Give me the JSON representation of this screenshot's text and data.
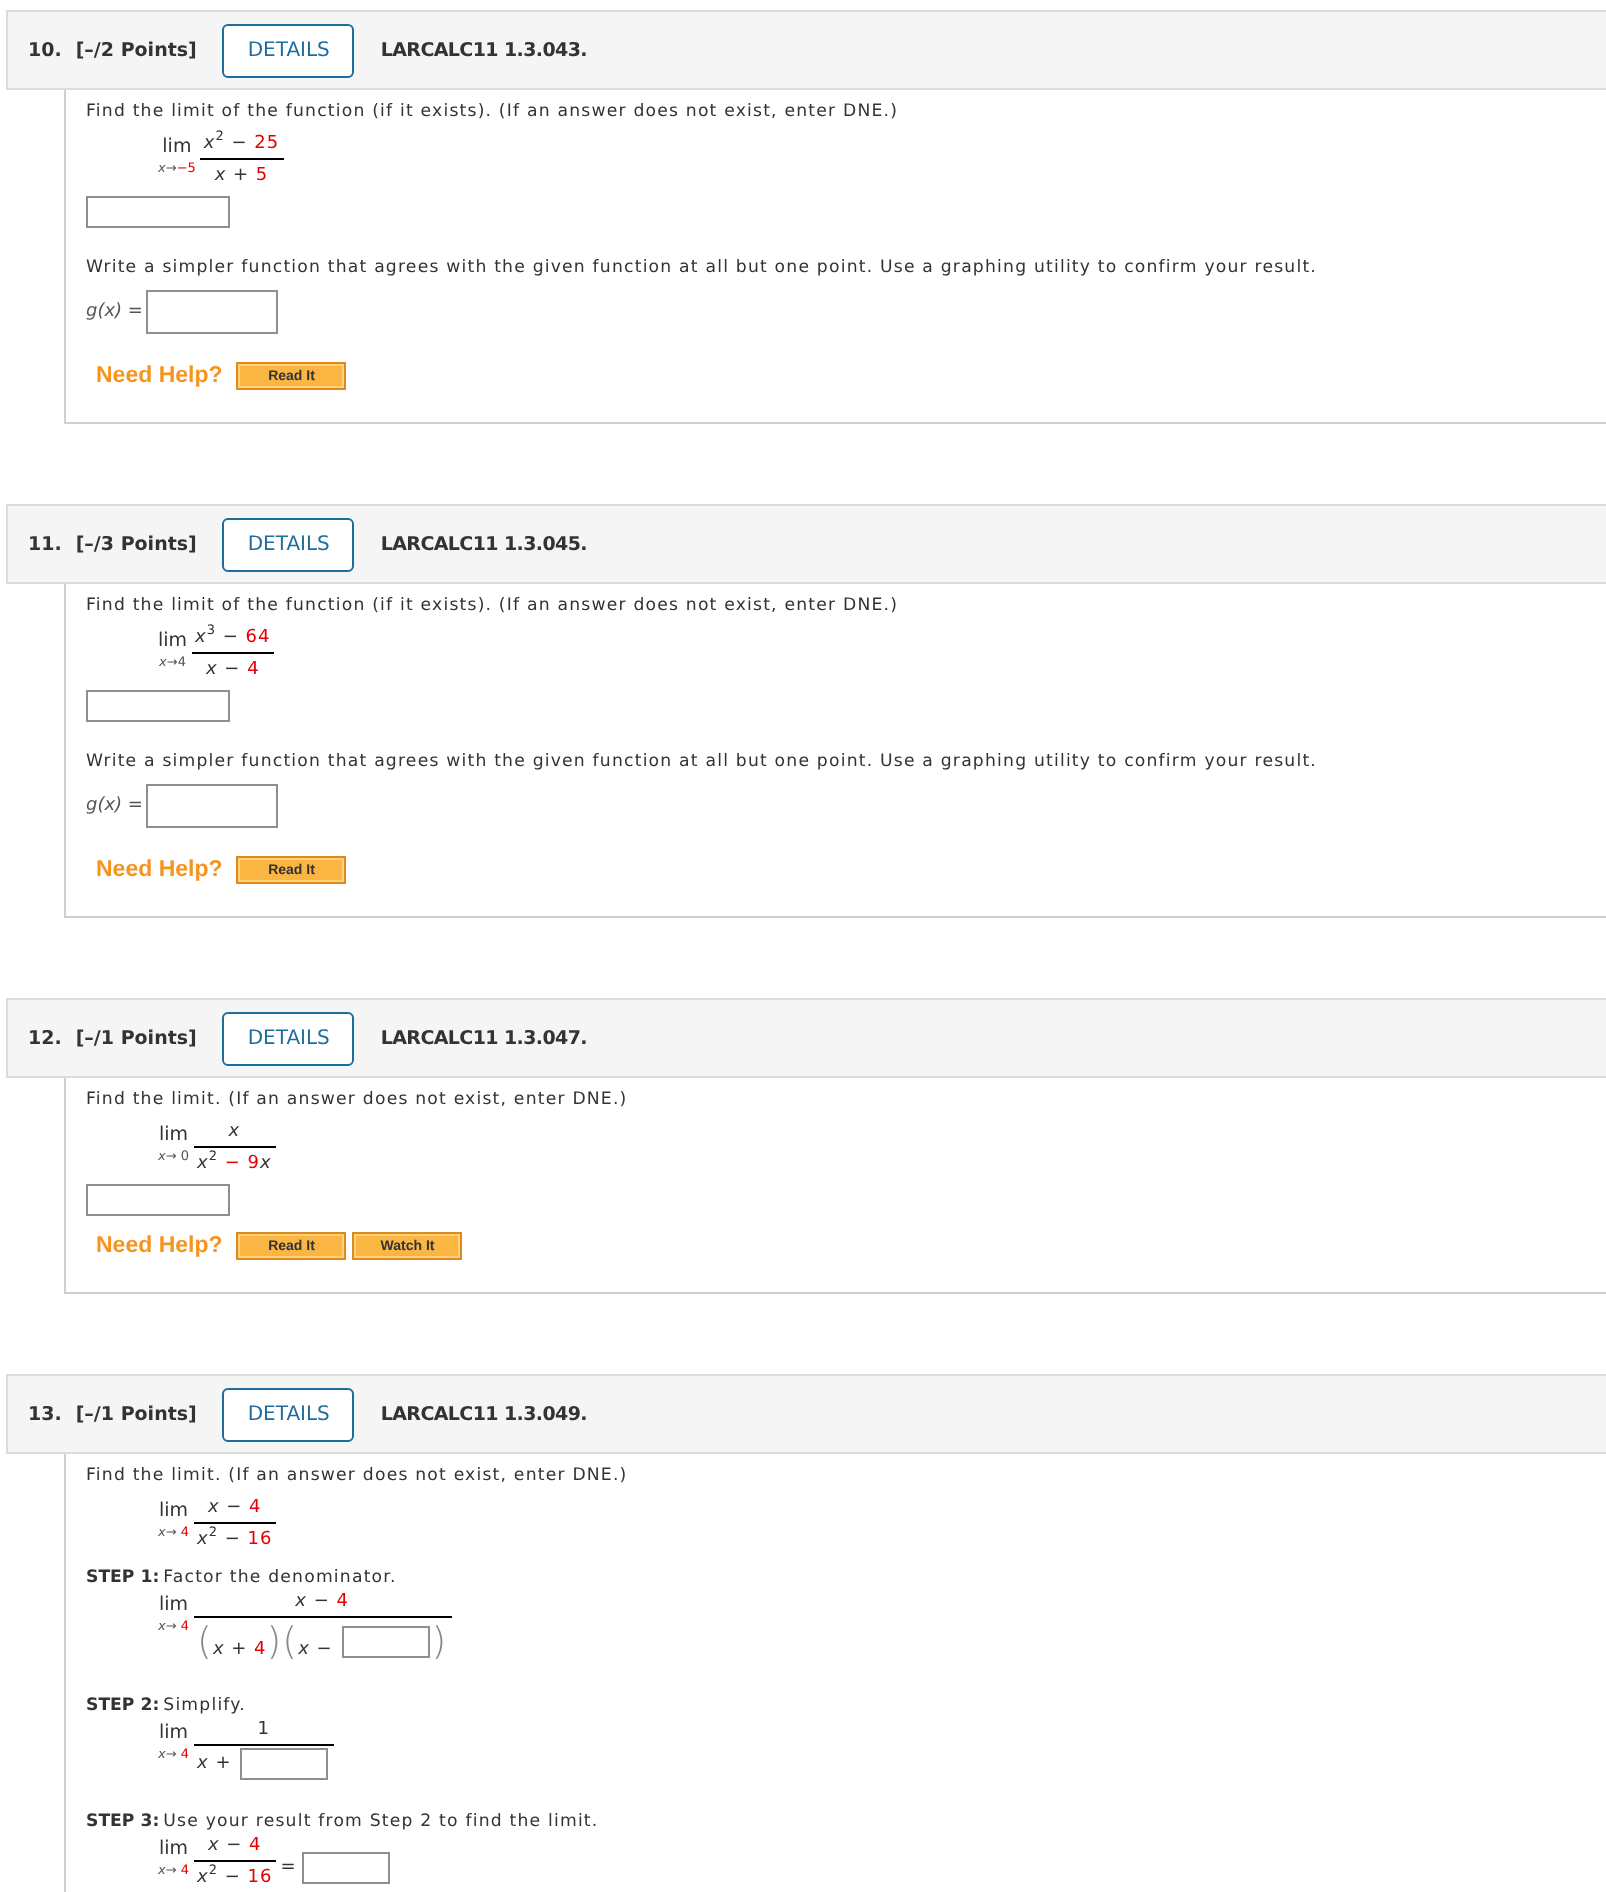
{
  "problems": [
    {
      "number": "10.",
      "points": "[–/2 Points]",
      "details": "DETAILS",
      "source": "LARCALC11 1.3.043.",
      "parts": [
        {
          "kind": "instruction",
          "text": "Find the limit of the function (if it exists). (If an answer does not exist, enter DNE.)"
        },
        {
          "kind": "limit",
          "lim": "lim",
          "approach": [
            {
              "kind": "var",
              "text": "x"
            },
            {
              "kind": "plain",
              "text": "→"
            },
            {
              "kind": "value",
              "text": "−5"
            }
          ],
          "numerator": [
            {
              "kind": "var",
              "text": "x"
            },
            {
              "kind": "sup",
              "text": "2"
            },
            {
              "kind": "plain",
              "text": " − "
            },
            {
              "kind": "value",
              "text": "25"
            }
          ],
          "denominator": [
            {
              "kind": "var",
              "text": "x"
            },
            {
              "kind": "plain",
              "text": " + "
            },
            {
              "kind": "value",
              "text": "5"
            }
          ]
        },
        {
          "kind": "answer_field"
        },
        {
          "kind": "instruction",
          "text": "Write a simpler function that agrees with the given function at all but one point. Use a graphing utility to confirm your result."
        },
        {
          "kind": "function_answer",
          "label": [
            {
              "kind": "var",
              "text": "g(x)"
            },
            {
              "kind": "plain",
              "text": " ="
            }
          ]
        }
      ],
      "help": {
        "label": "Need Help?",
        "buttons": [
          "Read It"
        ]
      }
    },
    {
      "number": "11.",
      "points": "[–/3 Points]",
      "details": "DETAILS",
      "source": "LARCALC11 1.3.045.",
      "parts": [
        {
          "kind": "instruction",
          "text": "Find the limit of the function (if it exists). (If an answer does not exist, enter DNE.)"
        },
        {
          "kind": "limit",
          "lim": "lim",
          "approach": [
            {
              "kind": "var",
              "text": "x"
            },
            {
              "kind": "plain",
              "text": "→"
            },
            {
              "kind": "plain",
              "text": "4"
            }
          ],
          "numerator": [
            {
              "kind": "var",
              "text": "x"
            },
            {
              "kind": "sup",
              "text": "3"
            },
            {
              "kind": "plain",
              "text": " − "
            },
            {
              "kind": "value",
              "text": "64"
            }
          ],
          "denominator": [
            {
              "kind": "var",
              "text": "x"
            },
            {
              "kind": "plain",
              "text": " − "
            },
            {
              "kind": "value",
              "text": "4"
            }
          ]
        },
        {
          "kind": "answer_field"
        },
        {
          "kind": "instruction",
          "text": "Write a simpler function that agrees with the given function at all but one point. Use a graphing utility to confirm your result."
        },
        {
          "kind": "function_answer",
          "label": [
            {
              "kind": "var",
              "text": "g(x)"
            },
            {
              "kind": "plain",
              "text": " ="
            }
          ]
        }
      ],
      "help": {
        "label": "Need Help?",
        "buttons": [
          "Read It"
        ]
      }
    },
    {
      "number": "12.",
      "points": "[–/1 Points]",
      "details": "DETAILS",
      "source": "LARCALC11 1.3.047.",
      "parts": [
        {
          "kind": "instruction",
          "text": "Find the limit. (If an answer does not exist, enter DNE.)"
        },
        {
          "kind": "limit",
          "lim": "lim",
          "approach": [
            {
              "kind": "var",
              "text": "x"
            },
            {
              "kind": "plain",
              "text": "→ 0"
            }
          ],
          "numerator": [
            {
              "kind": "var",
              "text": "x"
            }
          ],
          "denominator": [
            {
              "kind": "var",
              "text": "x"
            },
            {
              "kind": "sup",
              "text": "2"
            },
            {
              "kind": "value",
              "text": " − 9"
            },
            {
              "kind": "var",
              "text": "x"
            }
          ]
        },
        {
          "kind": "answer_field"
        }
      ],
      "help": {
        "label": "Need Help?",
        "buttons": [
          "Read It",
          "Watch It"
        ]
      }
    },
    {
      "number": "13.",
      "points": "[–/1 Points]",
      "details": "DETAILS",
      "source": "LARCALC11 1.3.049.",
      "parts": [
        {
          "kind": "instruction",
          "text": "Find the limit. (If an answer does not exist, enter DNE.)"
        },
        {
          "kind": "limit",
          "lim": "lim",
          "approach": [
            {
              "kind": "var",
              "text": "x"
            },
            {
              "kind": "plain",
              "text": "→ "
            },
            {
              "kind": "value",
              "text": "4"
            }
          ],
          "numerator": [
            {
              "kind": "var",
              "text": "x"
            },
            {
              "kind": "plain",
              "text": " − "
            },
            {
              "kind": "value",
              "text": "4"
            }
          ],
          "denominator": [
            {
              "kind": "var",
              "text": "x"
            },
            {
              "kind": "sup",
              "text": "2"
            },
            {
              "kind": "plain",
              "text": " − "
            },
            {
              "kind": "value",
              "text": "16"
            }
          ]
        },
        {
          "kind": "step",
          "label": "STEP 1:",
          "text": "Factor the denominator."
        },
        {
          "kind": "limit",
          "lim": "lim",
          "approach": [
            {
              "kind": "var",
              "text": "x"
            },
            {
              "kind": "plain",
              "text": "→ "
            },
            {
              "kind": "value",
              "text": "4"
            }
          ],
          "numerator": [
            {
              "kind": "var",
              "text": "x"
            },
            {
              "kind": "plain",
              "text": " − "
            },
            {
              "kind": "value",
              "text": "4"
            }
          ],
          "denominator": [
            {
              "kind": "paren",
              "text": "("
            },
            {
              "kind": "var",
              "text": "x"
            },
            {
              "kind": "plain",
              "text": " + "
            },
            {
              "kind": "value",
              "text": "4"
            },
            {
              "kind": "paren",
              "text": ")("
            },
            {
              "kind": "var",
              "text": "x"
            },
            {
              "kind": "plain",
              "text": " − "
            },
            {
              "kind": "field"
            },
            {
              "kind": "paren",
              "text": ")"
            }
          ]
        },
        {
          "kind": "step",
          "label": "STEP 2:",
          "text": "Simplify."
        },
        {
          "kind": "limit",
          "lim": "lim",
          "approach": [
            {
              "kind": "var",
              "text": "x"
            },
            {
              "kind": "plain",
              "text": "→ "
            },
            {
              "kind": "value",
              "text": "4"
            }
          ],
          "numerator": [
            {
              "kind": "plain",
              "text": "1"
            }
          ],
          "denominator": [
            {
              "kind": "var",
              "text": "x"
            },
            {
              "kind": "plain",
              "text": " + "
            },
            {
              "kind": "field"
            }
          ]
        },
        {
          "kind": "step",
          "label": "STEP 3:",
          "text": "Use your result from Step 2 to find the limit."
        },
        {
          "kind": "limit",
          "lim": "lim",
          "approach": [
            {
              "kind": "var",
              "text": "x"
            },
            {
              "kind": "plain",
              "text": "→ "
            },
            {
              "kind": "value",
              "text": "4"
            }
          ],
          "numerator": [
            {
              "kind": "var",
              "text": "x"
            },
            {
              "kind": "plain",
              "text": " − "
            },
            {
              "kind": "value",
              "text": "4"
            }
          ],
          "denominator": [
            {
              "kind": "var",
              "text": "x"
            },
            {
              "kind": "sup",
              "text": "2"
            },
            {
              "kind": "plain",
              "text": " − "
            },
            {
              "kind": "value",
              "text": "16"
            }
          ],
          "after": [
            {
              "kind": "plain",
              "text": "="
            },
            {
              "kind": "field"
            }
          ]
        }
      ]
    }
  ]
}
